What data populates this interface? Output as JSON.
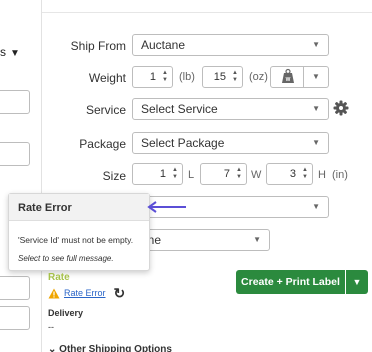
{
  "left_panel": {
    "label": "ss",
    "caret": "▼"
  },
  "form": {
    "ship_from": {
      "label": "Ship From",
      "value": "Auctane"
    },
    "weight": {
      "label": "Weight",
      "lb_value": "1",
      "lb_unit": "(lb)",
      "oz_value": "15",
      "oz_unit": "(oz)"
    },
    "service": {
      "label": "Service",
      "placeholder": "Select Service"
    },
    "package": {
      "label": "Package",
      "placeholder": "Select Package"
    },
    "size": {
      "label": "Size",
      "length": "1",
      "length_unit": "L",
      "width": "7",
      "width_unit": "W",
      "height": "3",
      "height_unit": "H",
      "unit": "(in)"
    },
    "confirmation_partial": "one"
  },
  "tooltip": {
    "title": "Rate Error",
    "message": "'Service Id' must not be empty.",
    "hint": "Select to see full message."
  },
  "rate": {
    "label": "Rate",
    "error_link": "Rate Error",
    "delivery_label": "Delivery",
    "delivery_value": "--"
  },
  "actions": {
    "create_label": "Create + Print Label",
    "other_options": "Other Shipping Options"
  },
  "colors": {
    "accent_green": "#2b8a3e",
    "rate_label": "#a6c14a",
    "link_blue": "#2a65c8",
    "arrow": "#5b4fd6",
    "warning": "#f0a500"
  },
  "icons": {
    "dropdown": "chevron-down-icon",
    "spinner": "stepper-icon",
    "scale": "scale-icon",
    "gear": "gear-icon",
    "warning": "warning-icon",
    "refresh": "refresh-icon",
    "arrow": "arrow-left-icon"
  }
}
